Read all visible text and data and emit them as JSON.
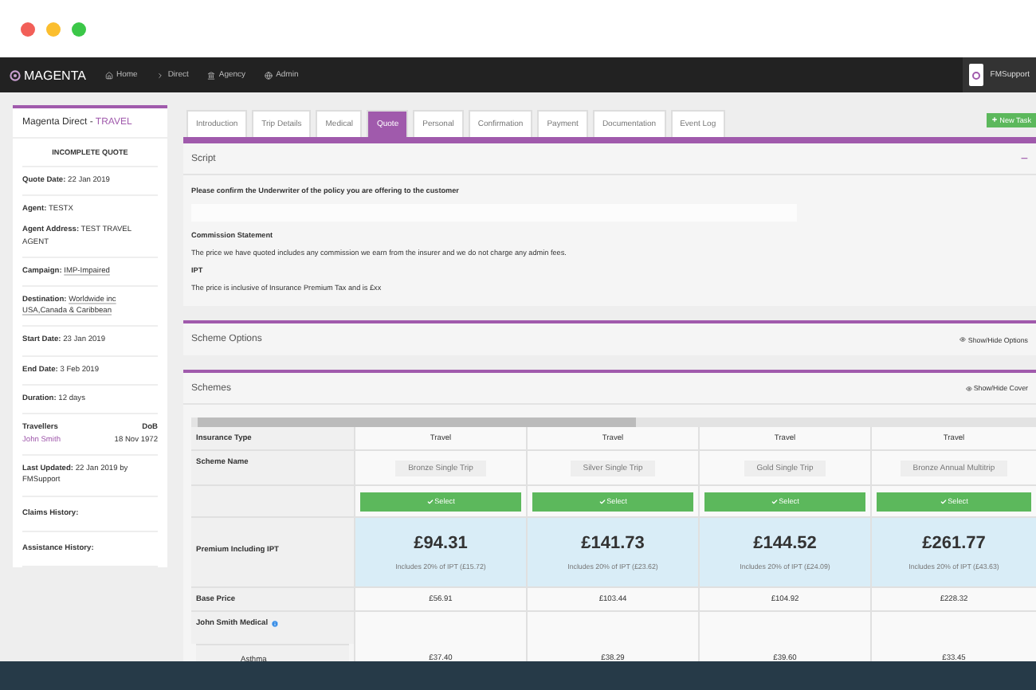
{
  "nav": {
    "brand": "MAGENTA",
    "items": [
      "Home",
      "Direct",
      "Agency",
      "Admin"
    ],
    "user": "FMSupport"
  },
  "sidebar": {
    "title": "Magenta Direct - ",
    "title_highlight": "TRAVEL",
    "status": "INCOMPLETE QUOTE",
    "groups": [
      [
        {
          "label": "Quote Date:",
          "value": "22 Jan 2019",
          "kind": "plain"
        }
      ],
      [
        {
          "label": "Agent:",
          "value": "TESTX",
          "kind": "plain"
        },
        {
          "label": "Agent Address:",
          "value": "TEST TRAVEL AGENT",
          "kind": "plain"
        }
      ],
      [
        {
          "label": "Campaign:",
          "value": "IMP-Impaired",
          "kind": "link"
        }
      ],
      [
        {
          "label": "Destination:",
          "value": "Worldwide inc USA,Canada & Caribbean",
          "kind": "link"
        }
      ],
      [
        {
          "label": "Start Date:",
          "value": "23 Jan 2019",
          "kind": "plain"
        }
      ],
      [
        {
          "label": "End Date:",
          "value": "3 Feb 2019",
          "kind": "plain"
        }
      ],
      [
        {
          "label": "Duration:",
          "value": "12 days",
          "kind": "plain"
        }
      ]
    ],
    "travellers": {
      "heading": "Travellers",
      "dob_heading": "DoB",
      "name": "John Smith",
      "dob": "18 Nov 1972"
    },
    "last_updated": {
      "label": "Last Updated:",
      "value": "22 Jan 2019 by FMSupport"
    },
    "histories": [
      "Claims History:",
      "Assistance History:"
    ]
  },
  "tabs": [
    {
      "label": "Introduction",
      "selected": false
    },
    {
      "label": "Trip Details",
      "selected": false
    },
    {
      "label": "Medical",
      "selected": false
    },
    {
      "label": "Quote",
      "selected": true
    },
    {
      "label": "Personal",
      "selected": false
    },
    {
      "label": "Confirmation",
      "selected": false
    },
    {
      "label": "Payment",
      "selected": false
    },
    {
      "label": "Documentation",
      "selected": false
    },
    {
      "label": "Event Log",
      "selected": false
    }
  ],
  "new_task": "New Task",
  "script": {
    "title": "Script",
    "collapse": "−",
    "items": [
      {
        "kind": "question",
        "text": "Please confirm the Underwriter of the policy you are offering to the customer"
      },
      {
        "kind": "field"
      },
      {
        "kind": "heading",
        "text": "Commission Statement"
      },
      {
        "kind": "text",
        "text": "The price we have quoted includes any commission we earn from the insurer and we do not charge any admin fees."
      },
      {
        "kind": "heading",
        "text": "IPT"
      },
      {
        "kind": "text",
        "text": "The price is inclusive of Insurance Premium Tax and is £xx"
      }
    ]
  },
  "scheme_options": {
    "title": "Scheme Options",
    "toggle": "Show/Hide Options"
  },
  "schemes": {
    "title": "Schemes",
    "toggle": "Show/Hide Cover",
    "row_labels": {
      "insurance_type": "Insurance Type",
      "scheme_name": "Scheme Name",
      "premium": "Premium Including IPT",
      "base_price": "Base Price",
      "medical": "John Smith Medical",
      "condition": "Asthma"
    },
    "columns": [
      {
        "insurance_type": "Travel",
        "select_label": "Select",
        "scheme_name": "Bronze Single Trip",
        "premium": "£94.31",
        "ipt_note": "Includes 20% of IPT (£15.72)",
        "base_price": "£56.91",
        "condition": "£37.40"
      },
      {
        "insurance_type": "Travel",
        "select_label": "Select",
        "scheme_name": "Silver Single Trip",
        "premium": "£141.73",
        "ipt_note": "Includes 20% of IPT (£23.62)",
        "base_price": "£103.44",
        "condition": "£38.29"
      },
      {
        "insurance_type": "Travel",
        "select_label": "Select",
        "scheme_name": "Gold Single Trip",
        "premium": "£144.52",
        "ipt_note": "Includes 20% of IPT (£24.09)",
        "base_price": "£104.92",
        "condition": "£39.60"
      },
      {
        "insurance_type": "Travel",
        "select_label": "Select",
        "scheme_name": "Bronze Annual Multitrip",
        "premium": "£261.77",
        "ipt_note": "Includes 20% of IPT (£43.63)",
        "base_price": "£228.32",
        "condition": "£33.45"
      }
    ]
  }
}
